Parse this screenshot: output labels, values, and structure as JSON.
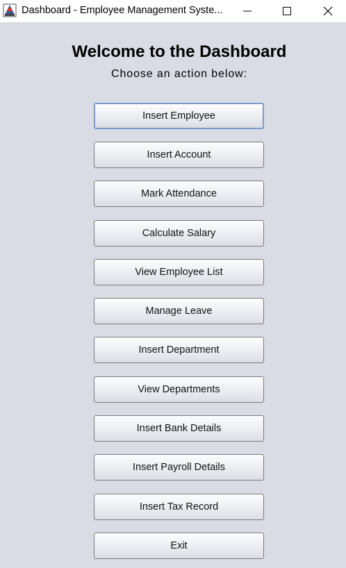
{
  "window": {
    "title": "Dashboard - Employee Management Syste...",
    "icon": "java-app-icon",
    "controls": [
      "minimize-icon",
      "maximize-icon",
      "close-icon"
    ]
  },
  "header": {
    "title": "Welcome to the Dashboard",
    "subtitle": "Choose an action below:"
  },
  "actions": [
    "Insert Employee",
    "Insert Account",
    "Mark Attendance",
    "Calculate Salary",
    "View Employee List",
    "Manage Leave",
    "Insert Department",
    "View Departments",
    "Insert Bank Details",
    "Insert Payroll Details",
    "Insert Tax Record",
    "Exit"
  ],
  "focused_action": "Insert Employee",
  "colors": {
    "background": "#d9dce4",
    "focus_border": "#7b9cc9"
  }
}
